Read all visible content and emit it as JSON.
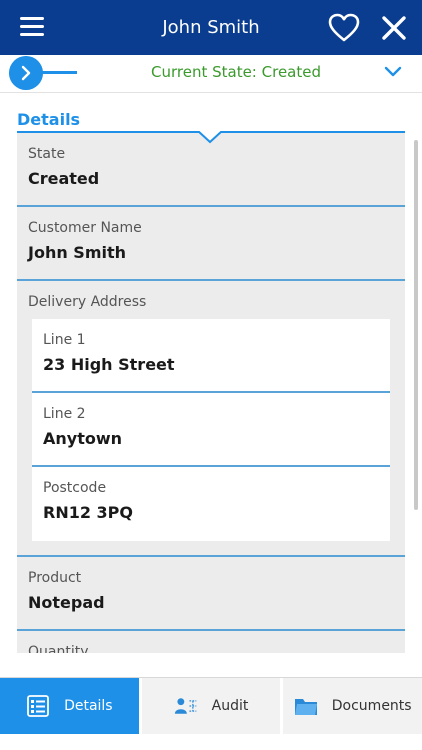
{
  "header": {
    "title": "John Smith",
    "icons": {
      "menu": "menu-icon",
      "favorite": "heart-icon",
      "close": "close-icon"
    },
    "background": "#0a3d8f"
  },
  "state_bar": {
    "label": "Current State: Created",
    "accent": "#1e90e8",
    "state_color": "#3a9a2c"
  },
  "section": {
    "title": "Details"
  },
  "fields": {
    "state": {
      "label": "State",
      "value": "Created"
    },
    "customer": {
      "label": "Customer Name",
      "value": "John Smith"
    },
    "address": {
      "label": "Delivery Address",
      "line1": {
        "label": "Line 1",
        "value": "23 High Street"
      },
      "line2": {
        "label": "Line 2",
        "value": "Anytown"
      },
      "postcode": {
        "label": "Postcode",
        "value": "RN12 3PQ"
      }
    },
    "product": {
      "label": "Product",
      "value": "Notepad"
    },
    "quantity": {
      "label": "Quantity"
    }
  },
  "tabs": [
    {
      "label": "Details",
      "icon": "details-icon",
      "active": true
    },
    {
      "label": "Audit",
      "icon": "audit-icon",
      "active": false
    },
    {
      "label": "Documents",
      "icon": "folder-icon",
      "active": false
    }
  ]
}
